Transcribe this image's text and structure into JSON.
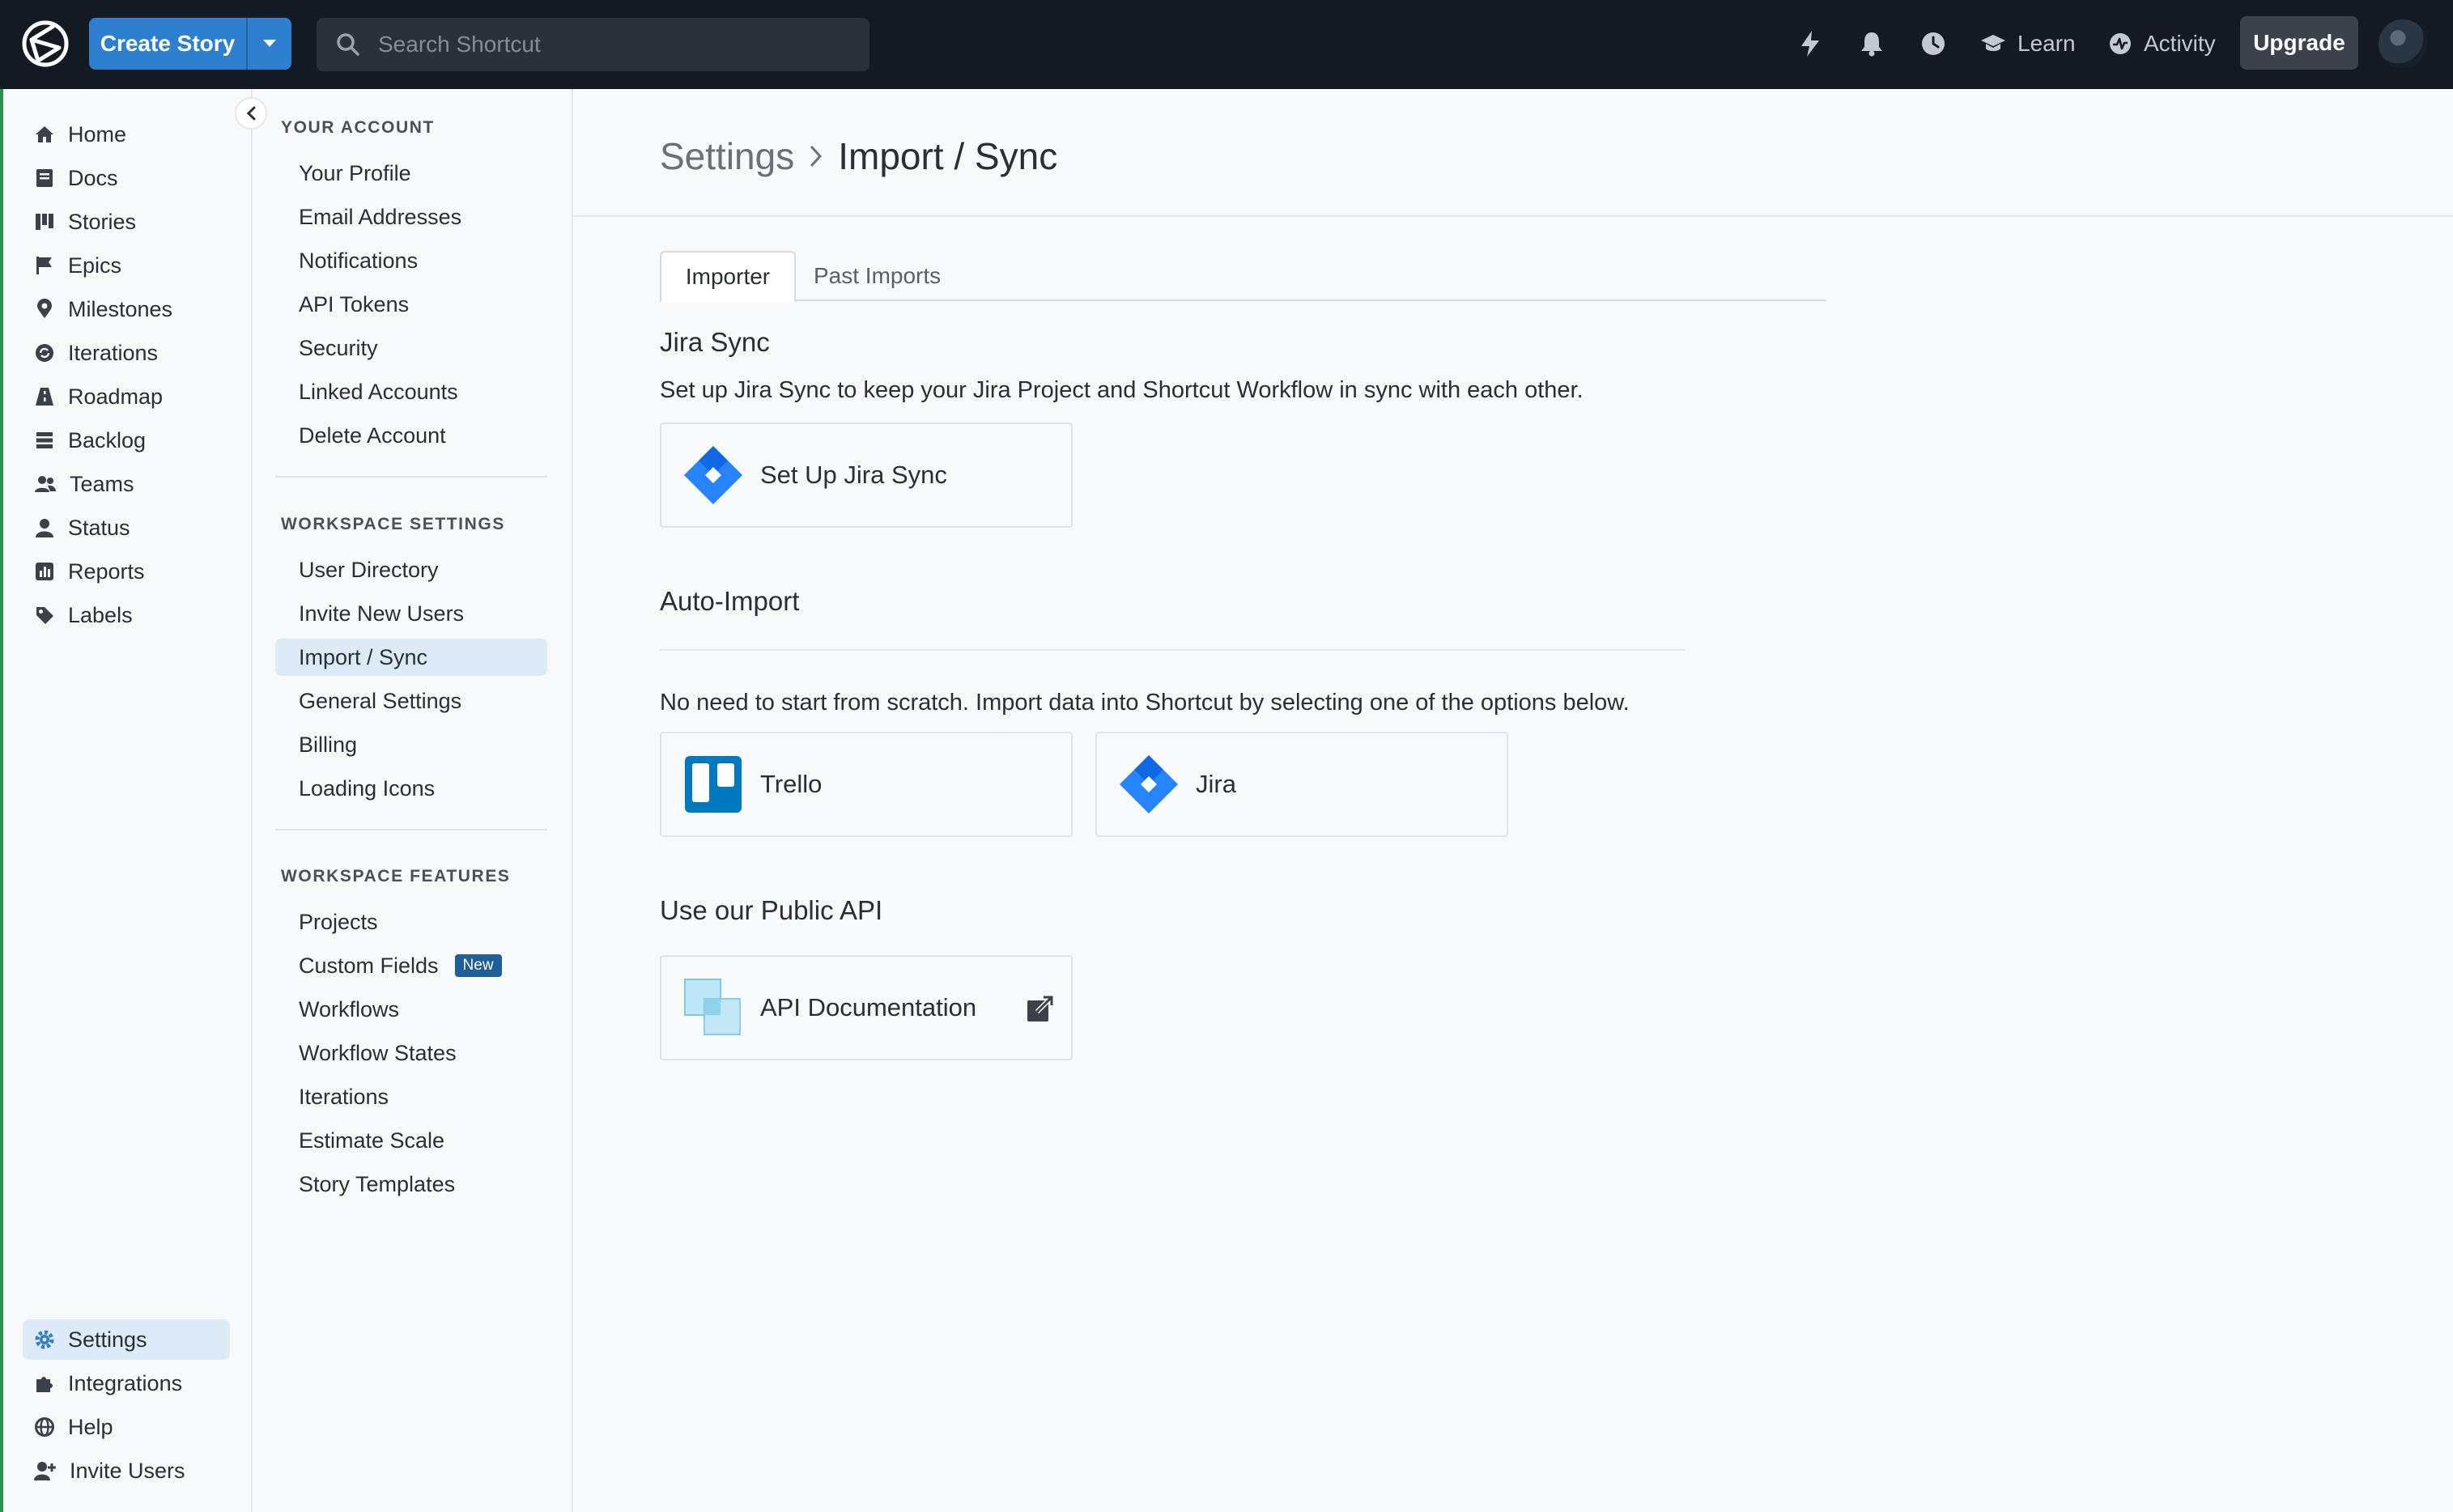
{
  "topbar": {
    "create_label": "Create Story",
    "search_placeholder": "Search Shortcut",
    "learn_label": "Learn",
    "activity_label": "Activity",
    "upgrade_label": "Upgrade"
  },
  "leftnav": {
    "items": [
      "Home",
      "Docs",
      "Stories",
      "Epics",
      "Milestones",
      "Iterations",
      "Roadmap",
      "Backlog",
      "Teams",
      "Status",
      "Reports",
      "Labels"
    ],
    "bottom": [
      "Settings",
      "Integrations",
      "Help",
      "Invite Users"
    ]
  },
  "settings_nav": {
    "account_heading": "YOUR ACCOUNT",
    "account_items": [
      "Your Profile",
      "Email Addresses",
      "Notifications",
      "API Tokens",
      "Security",
      "Linked Accounts",
      "Delete Account"
    ],
    "workspace_heading": "WORKSPACE SETTINGS",
    "workspace_items": [
      "User Directory",
      "Invite New Users",
      "Import / Sync",
      "General Settings",
      "Billing",
      "Loading Icons"
    ],
    "features_heading": "WORKSPACE FEATURES",
    "features_items": [
      "Projects",
      "Custom Fields",
      "Workflows",
      "Workflow States",
      "Iterations",
      "Estimate Scale",
      "Story Templates"
    ],
    "new_badge": "New"
  },
  "main": {
    "breadcrumb_parent": "Settings",
    "breadcrumb_current": "Import / Sync",
    "tabs": [
      "Importer",
      "Past Imports"
    ],
    "jira_sync": {
      "title": "Jira Sync",
      "description": "Set up Jira Sync to keep your Jira Project and Shortcut Workflow in sync with each other.",
      "button": "Set Up Jira Sync"
    },
    "auto_import": {
      "title": "Auto-Import",
      "description": "No need to start from scratch. Import data into Shortcut by selecting one of the options below.",
      "options": [
        "Trello",
        "Jira"
      ]
    },
    "public_api": {
      "title": "Use our Public API",
      "button": "API Documentation"
    }
  },
  "colors": {
    "topbar": "#141a23",
    "accent": "#2f7fd1",
    "active_bg": "#dcebf7",
    "jira_blue": "#2684ff",
    "trello_blue": "#0079bf"
  }
}
